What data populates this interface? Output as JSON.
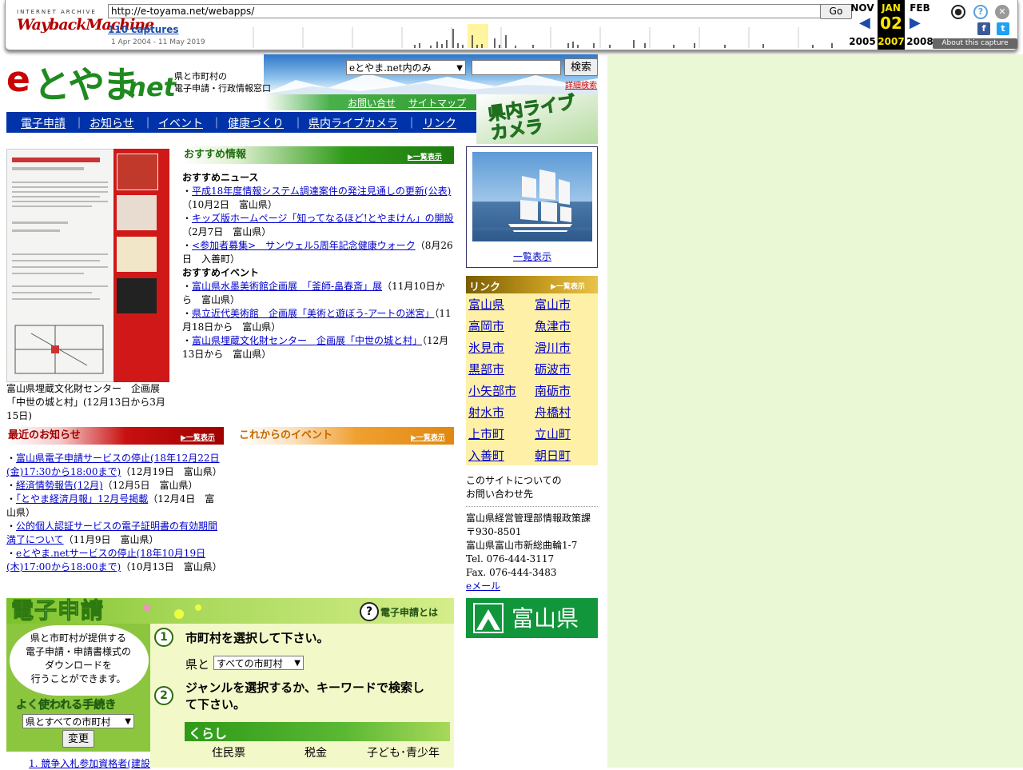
{
  "wayback": {
    "brand_small": "INTERNET ARCHIVE",
    "brand_logo": "WaybackMachine",
    "url": "http://e-toyama.net/webapps/",
    "go_label": "Go",
    "captures": "110 captures",
    "date_range": "1 Apr 2004 - 11 May 2019",
    "prev_month": "NOV",
    "cur_month": "JAN",
    "next_month": "FEB",
    "cur_day": "02",
    "prev_year": "2005",
    "cur_year": "2007",
    "next_year": "2008",
    "about": "About this capture"
  },
  "header": {
    "logo_e": "e",
    "logo_main": "とやま",
    "logo_net": ".net",
    "tagline_1": "県と市町村の",
    "tagline_2": "電子申請・行政情報窓口",
    "site_select": "eとやま.net内のみ",
    "search_label": "検索",
    "advanced_search": "詳細検索",
    "contact_link": "お問い合せ",
    "sitemap_link": "サイトマップ",
    "livecam_banner": "県内ライブカメラ"
  },
  "nav": {
    "items": [
      "電子申請",
      "お知らせ",
      "イベント",
      "健康づくり",
      "県内ライブカメラ",
      "リンク"
    ],
    "sep": "｜"
  },
  "poster": {
    "caption": "富山県埋蔵文化財センター　企画展「中世の城と村」(12月13日から3月15日)"
  },
  "recommend": {
    "header": "おすすめ情報",
    "list_all": "▶一覧表示",
    "news_title": "おすすめニュース",
    "news": [
      {
        "link": "平成18年度情報システム調達案件の発注見通しの更新(公表)",
        "meta": "（10月2日　富山県）"
      },
      {
        "link": "キッズ版ホームページ「知ってなるほど!とやまけん」の開設",
        "meta": "（2月7日　富山県）"
      },
      {
        "link": "<参加者募集>　サンウェル5周年記念健康ウォーク",
        "meta": "（8月26日　入善町）"
      }
    ],
    "events_title": "おすすめイベント",
    "events": [
      {
        "link": "富山県水墨美術館企画展　「釜師-畠春斎」展",
        "meta": "（11月10日から　富山県）"
      },
      {
        "link": "県立近代美術館　企画展「美術と遊ぼう-アートの迷宮」",
        "meta": "（11月18日から　富山県）"
      },
      {
        "link": "富山県埋蔵文化財センター　企画展「中世の城と村」",
        "meta": "（12月13日から　富山県）"
      }
    ]
  },
  "notices": {
    "header": "最近のお知らせ",
    "list_all": "▶一覧表示",
    "items": [
      {
        "link": "富山県電子申請サービスの停止(18年12月22日(金)17:30から18:00まで)",
        "meta": "（12月19日　富山県）"
      },
      {
        "link": "経済情勢報告(12月)",
        "meta": "（12月5日　富山県）"
      },
      {
        "link": "「とやま経済月報」12月号掲載",
        "meta": "（12月4日　富山県）"
      },
      {
        "link": "公的個人認証サービスの電子証明書の有効期間満了について",
        "meta": "（11月9日　富山県）"
      },
      {
        "link": "eとやま.netサービスの停止(18年10月19日(木)17:00から18:00まで)",
        "meta": "（10月13日　富山県）"
      }
    ]
  },
  "events": {
    "header": "これからのイベント",
    "list_all": "▶一覧表示"
  },
  "camera": {
    "list_all": "一覧表示"
  },
  "links": {
    "header": "リンク",
    "list_all": "▶一覧表示",
    "items": [
      "富山県",
      "富山市",
      "高岡市",
      "魚津市",
      "氷見市",
      "滑川市",
      "黒部市",
      "砺波市",
      "小矢部市",
      "南砺市",
      "射水市",
      "舟橋村",
      "上市町",
      "立山町",
      "入善町",
      "朝日町"
    ]
  },
  "about": {
    "line1": "このサイトについての",
    "line2": "お問い合わせ先",
    "dept": "富山県経営管理部情報政策課",
    "zip": "〒930-8501",
    "address": "富山県富山市新総曲輪1-7",
    "tel": "Tel. 076-444-3117",
    "fax": "Fax. 076-444-3483",
    "email": "eメール",
    "pref_logo": "富山県"
  },
  "eapp": {
    "title": "電子申請",
    "what": "電子申請とは",
    "desc_1": "県と市町村が提供する",
    "desc_2": "電子申請・申請書様式の",
    "desc_3": "ダウンロードを",
    "desc_4": "行うことができます。",
    "frequent": "よく使われる手続き",
    "frequent_select": "県とすべての市町村",
    "change_btn": "変更",
    "first_item": "1. 競争入札参加資格者(建設",
    "step1_num": "1",
    "step1": "市町村を選択して下さい。",
    "pref_and": "県と",
    "muni_select": "すべての市町村",
    "step2_num": "2",
    "step2a": "ジャンルを選択するか、キーワードで検索し",
    "step2b": "て下さい。",
    "category": "くらし",
    "genres": [
      "住民票",
      "税金",
      "子ども･青少年"
    ]
  }
}
